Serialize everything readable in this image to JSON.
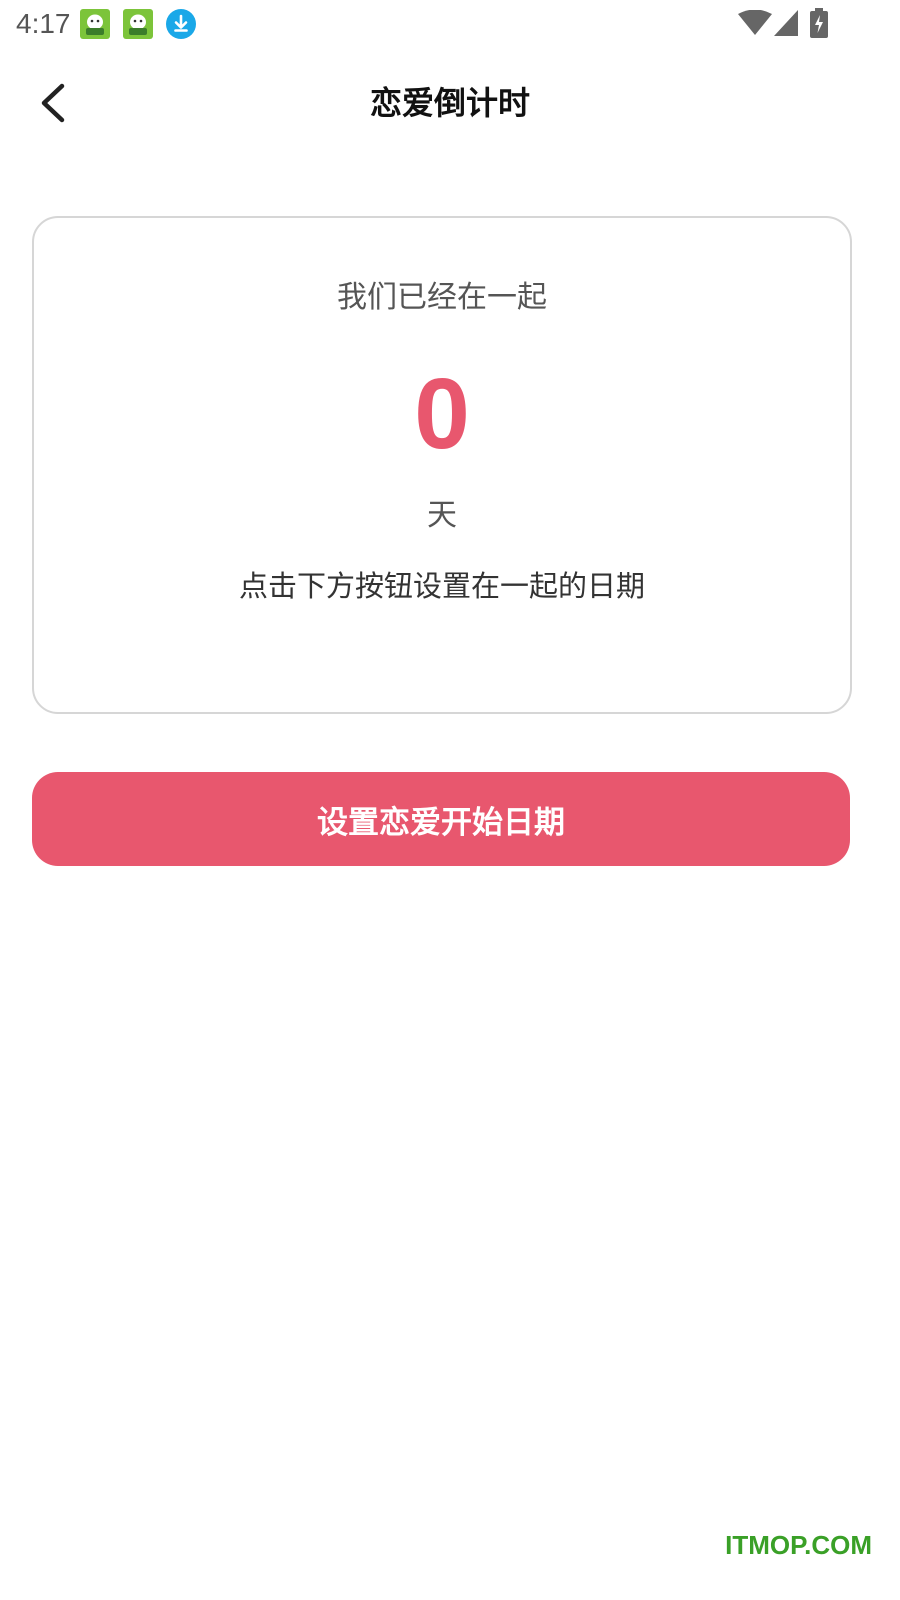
{
  "status_bar": {
    "time": "4:17",
    "notification_icons": [
      "app-mascot-icon",
      "app-mascot-icon",
      "download-icon"
    ],
    "right_icons": [
      "wifi-icon",
      "cellular-signal-icon",
      "battery-charging-icon"
    ]
  },
  "header": {
    "title": "恋爱倒计时",
    "back_icon": "chevron-left-icon"
  },
  "card": {
    "subtitle": "我们已经在一起",
    "days_count": "0",
    "unit": "天",
    "hint": "点击下方按钮设置在一起的日期"
  },
  "actions": {
    "set_start_date_label": "设置恋爱开始日期"
  },
  "watermark": {
    "text": "ITMOP.COM"
  },
  "colors": {
    "accent": "#e8576e",
    "card_border": "#d6d6d6",
    "watermark": "#3aa027",
    "download_icon": "#1aa8e8",
    "mascot_icon_bg": "#7cc43a"
  }
}
